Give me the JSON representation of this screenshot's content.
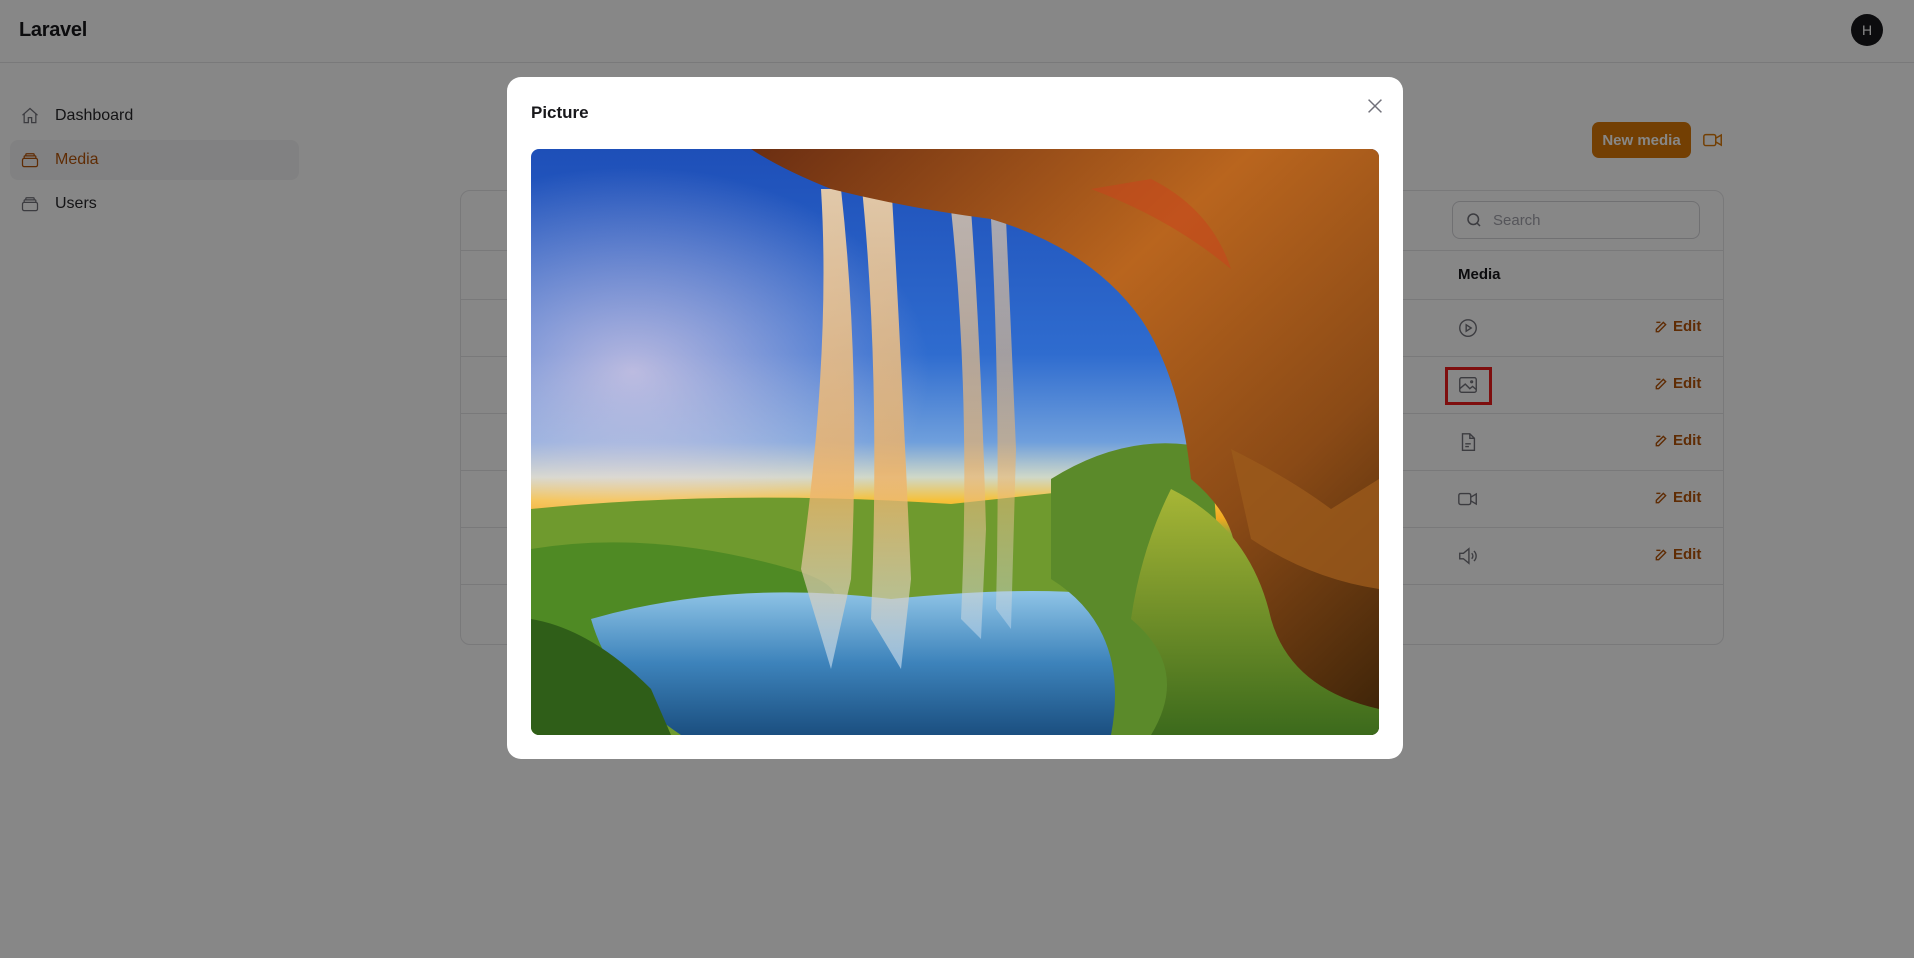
{
  "app": {
    "brand": "Laravel",
    "user_initial": "H"
  },
  "sidebar": {
    "items": [
      {
        "label": "Dashboard",
        "icon": "home-icon",
        "active": false
      },
      {
        "label": "Media",
        "icon": "layers-icon",
        "active": true
      },
      {
        "label": "Users",
        "icon": "layers-icon",
        "active": false
      }
    ]
  },
  "toolbar": {
    "new_media_label": "New media",
    "video_icon": "video-icon"
  },
  "search": {
    "placeholder": "Search",
    "value": ""
  },
  "table": {
    "columns": [
      "Media"
    ],
    "rows": [
      {
        "media_icon": "play-circle-icon",
        "action": "Edit"
      },
      {
        "media_icon": "image-icon",
        "action": "Edit",
        "highlighted": true
      },
      {
        "media_icon": "document-icon",
        "action": "Edit"
      },
      {
        "media_icon": "video-icon",
        "action": "Edit"
      },
      {
        "media_icon": "speaker-icon",
        "action": "Edit"
      }
    ]
  },
  "modal": {
    "title": "Picture",
    "close_icon": "close-icon",
    "image_subject": "waterfall-cave-photo"
  },
  "colors": {
    "accent": "#d97706",
    "accent_text": "#b45309",
    "highlight": "#ef1c1c",
    "overlay": "rgba(0,0,0,0.47)"
  }
}
